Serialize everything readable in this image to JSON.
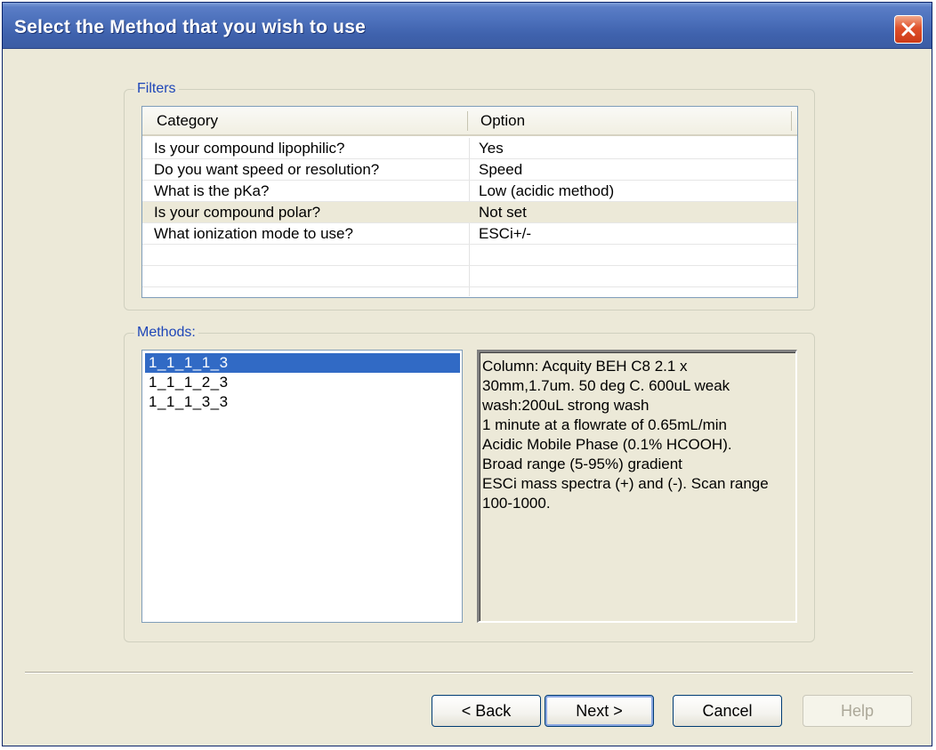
{
  "window": {
    "title": "Select the Method that you wish to use"
  },
  "filters": {
    "legend": "Filters",
    "columns": [
      "Category",
      "Option"
    ],
    "rows": [
      {
        "category": "Is your compound lipophilic?",
        "option": "Yes"
      },
      {
        "category": "Do you want speed or resolution?",
        "option": "Speed"
      },
      {
        "category": "What is the pKa?",
        "option": "Low (acidic method)"
      },
      {
        "category": "Is your compound polar?",
        "option": "Not set"
      },
      {
        "category": "What ionization mode to use?",
        "option": "ESCi+/-"
      }
    ]
  },
  "methods": {
    "legend": "Methods:",
    "items": [
      "1_1_1_1_3",
      "1_1_1_2_3",
      "1_1_1_3_3"
    ],
    "selected": "1_1_1_1_3",
    "description": [
      "Column: Acquity BEH C8 2.1 x",
      "30mm,1.7um. 50 deg C. 600uL weak",
      "wash:200uL strong wash",
      "1 minute at a flowrate of 0.65mL/min",
      "Acidic Mobile Phase (0.1% HCOOH).",
      "Broad range (5-95%) gradient",
      "ESCi mass spectra (+) and (-). Scan range",
      "100-1000."
    ]
  },
  "buttons": {
    "back": "< Back",
    "next": "Next >",
    "cancel": "Cancel",
    "help": "Help"
  },
  "icons": {
    "close": "close-icon"
  },
  "colors": {
    "titlebar": "#3f62ad",
    "selection": "#316ac5",
    "legend_text": "#1e46b8",
    "close_button": "#e0512b"
  }
}
